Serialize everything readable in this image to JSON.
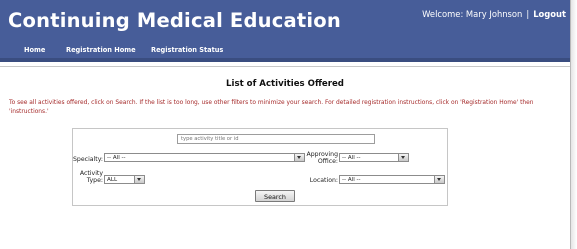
{
  "header": {
    "app_title": "Continuing Medical Education",
    "welcome_text": "Welcome: Mary Johnson",
    "separator": "|",
    "logout_label": "Logout"
  },
  "nav": {
    "items": [
      {
        "label": "Home"
      },
      {
        "label": "Registration Home"
      },
      {
        "label": "Registration Status"
      }
    ]
  },
  "main": {
    "title": "List of Activities Offered",
    "instructions": "To see all activities offered, click on Search. If the list is too long, use other filters to minimize your search. For detailed registration instructions, click on 'Registration Home' then 'instructions.'"
  },
  "search": {
    "title_placeholder": "type activity title or id",
    "title_value": "",
    "specialty": {
      "label": "Specialty:",
      "selected": "-- All --"
    },
    "approving_office": {
      "label_line1": "Approving",
      "label_line2": "Office:",
      "selected": "-- All --"
    },
    "activity_type": {
      "label_line1": "Activity",
      "label_line2": "Type:",
      "selected": "ALL"
    },
    "location": {
      "label": "Location:",
      "selected": "-- All --"
    },
    "button_label": "Search"
  },
  "colors": {
    "header_bg": "#475d99",
    "instruction_text": "#a52a2a"
  }
}
